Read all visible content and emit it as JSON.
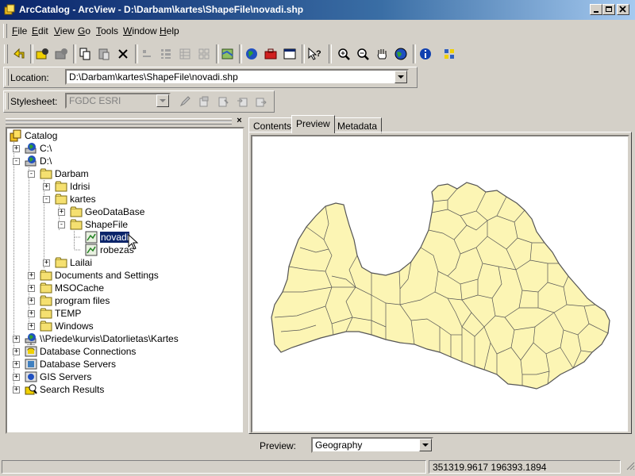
{
  "window": {
    "title": "ArcCatalog - ArcView - D:\\Darbam\\kartes\\ShapeFile\\novadi.shp"
  },
  "menu": [
    {
      "label": "File",
      "key": "F",
      "rest": "ile"
    },
    {
      "label": "Edit",
      "key": "E",
      "rest": "dit"
    },
    {
      "label": "View",
      "key": "V",
      "rest": "iew"
    },
    {
      "label": "Go",
      "key": "G",
      "rest": "o"
    },
    {
      "label": "Tools",
      "key": "T",
      "rest": "ools"
    },
    {
      "label": "Window",
      "key": "W",
      "rest": "indow"
    },
    {
      "label": "Help",
      "key": "H",
      "rest": "elp"
    }
  ],
  "location": {
    "label": "Location:",
    "value": "D:\\Darbam\\kartes\\ShapeFile\\novadi.shp"
  },
  "stylesheet": {
    "label": "Stylesheet:",
    "value": "FGDC ESRI"
  },
  "tree": {
    "root": "Catalog",
    "items": [
      {
        "label": "C:\\"
      },
      {
        "label": "D:\\"
      },
      {
        "label": "Darbam"
      },
      {
        "label": "Idrisi"
      },
      {
        "label": "kartes"
      },
      {
        "label": "GeoDataBase"
      },
      {
        "label": "ShapeFile"
      },
      {
        "label": "novadi"
      },
      {
        "label": "robezas"
      },
      {
        "label": "Lailai"
      },
      {
        "label": "Documents and Settings"
      },
      {
        "label": "MSOCache"
      },
      {
        "label": "program files"
      },
      {
        "label": "TEMP"
      },
      {
        "label": "Windows"
      },
      {
        "label": "\\\\Priede\\kurvis\\Datorlietas\\Kartes"
      },
      {
        "label": "Database Connections"
      },
      {
        "label": "Database Servers"
      },
      {
        "label": "GIS Servers"
      },
      {
        "label": "Search Results"
      }
    ]
  },
  "tabs": [
    {
      "label": "Contents"
    },
    {
      "label": "Preview"
    },
    {
      "label": "Metadata"
    }
  ],
  "preview": {
    "label": "Preview:",
    "value": "Geography",
    "fill_color": "#fcf5b4",
    "stroke_color": "#555555"
  },
  "status": {
    "coordinates": "351319.9617  196393.1894"
  }
}
